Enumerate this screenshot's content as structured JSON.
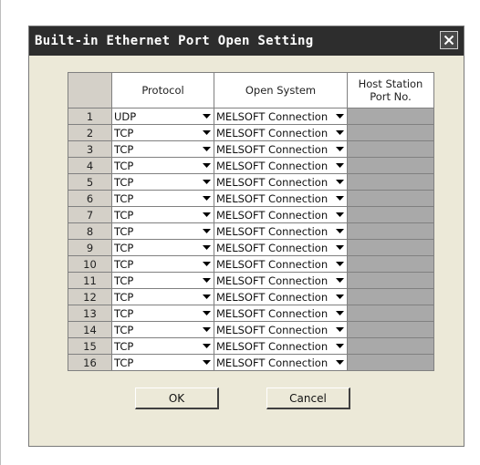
{
  "dialog": {
    "title": "Built-in Ethernet Port Open Setting",
    "ok_label": "OK",
    "cancel_label": "Cancel"
  },
  "table": {
    "headers": {
      "protocol": "Protocol",
      "open_system": "Open System",
      "host_port_line1": "Host Station",
      "host_port_line2": "Port No."
    },
    "rows": [
      {
        "num": "1",
        "protocol": "UDP",
        "open_system": "MELSOFT Connection",
        "port": ""
      },
      {
        "num": "2",
        "protocol": "TCP",
        "open_system": "MELSOFT Connection",
        "port": ""
      },
      {
        "num": "3",
        "protocol": "TCP",
        "open_system": "MELSOFT Connection",
        "port": ""
      },
      {
        "num": "4",
        "protocol": "TCP",
        "open_system": "MELSOFT Connection",
        "port": ""
      },
      {
        "num": "5",
        "protocol": "TCP",
        "open_system": "MELSOFT Connection",
        "port": ""
      },
      {
        "num": "6",
        "protocol": "TCP",
        "open_system": "MELSOFT Connection",
        "port": ""
      },
      {
        "num": "7",
        "protocol": "TCP",
        "open_system": "MELSOFT Connection",
        "port": ""
      },
      {
        "num": "8",
        "protocol": "TCP",
        "open_system": "MELSOFT Connection",
        "port": ""
      },
      {
        "num": "9",
        "protocol": "TCP",
        "open_system": "MELSOFT Connection",
        "port": ""
      },
      {
        "num": "10",
        "protocol": "TCP",
        "open_system": "MELSOFT Connection",
        "port": ""
      },
      {
        "num": "11",
        "protocol": "TCP",
        "open_system": "MELSOFT Connection",
        "port": ""
      },
      {
        "num": "12",
        "protocol": "TCP",
        "open_system": "MELSOFT Connection",
        "port": ""
      },
      {
        "num": "13",
        "protocol": "TCP",
        "open_system": "MELSOFT Connection",
        "port": ""
      },
      {
        "num": "14",
        "protocol": "TCP",
        "open_system": "MELSOFT Connection",
        "port": ""
      },
      {
        "num": "15",
        "protocol": "TCP",
        "open_system": "MELSOFT Connection",
        "port": ""
      },
      {
        "num": "16",
        "protocol": "TCP",
        "open_system": "MELSOFT Connection",
        "port": ""
      }
    ]
  },
  "icons": {
    "close": "close-icon",
    "dropdown": "chevron-down-icon"
  },
  "colors": {
    "titlebar": "#2d2d2d",
    "dialog_bg": "#ece9d8",
    "disabled_cell": "#a9a9a9"
  }
}
